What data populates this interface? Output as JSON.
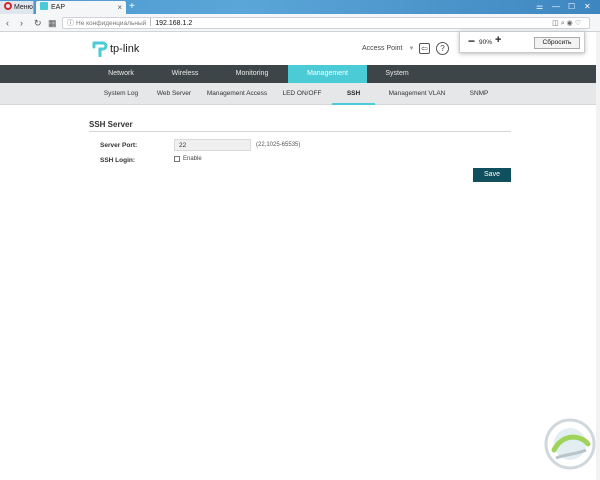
{
  "browser": {
    "tabs": [
      {
        "label": "Меню"
      },
      {
        "label": "EAP"
      }
    ],
    "new_tab_label": "+",
    "address": {
      "security_label": "Не конфиденциальный",
      "url": "192.168.1.2"
    },
    "zoom": {
      "level": "90%",
      "minus": "−",
      "plus": "+",
      "reset_label": "Сбросить"
    }
  },
  "header": {
    "brand": "tp-link",
    "mode_label": "Access Point",
    "help_glyph": "?",
    "logout_glyph": "⇦"
  },
  "main_nav": [
    {
      "label": "Network"
    },
    {
      "label": "Wireless"
    },
    {
      "label": "Monitoring"
    },
    {
      "label": "Management",
      "active": true
    },
    {
      "label": "System"
    }
  ],
  "sub_nav": [
    {
      "label": "System Log"
    },
    {
      "label": "Web Server"
    },
    {
      "label": "Management Access"
    },
    {
      "label": "LED ON/OFF"
    },
    {
      "label": "SSH",
      "active": true
    },
    {
      "label": "Management VLAN"
    },
    {
      "label": "SNMP"
    }
  ],
  "ssh_server": {
    "title": "SSH Server",
    "server_port_label": "Server Port:",
    "server_port_value": "22",
    "server_port_hint": "(22,1025-65535)",
    "ssh_login_label": "SSH Login:",
    "enable_label": "Enable",
    "enable_checked": false,
    "save_label": "Save"
  },
  "colors": {
    "accent": "#4acbd6",
    "nav_bg": "#3e4548",
    "subnav_bg": "#e6e7e8",
    "save_bg": "#10505e"
  }
}
